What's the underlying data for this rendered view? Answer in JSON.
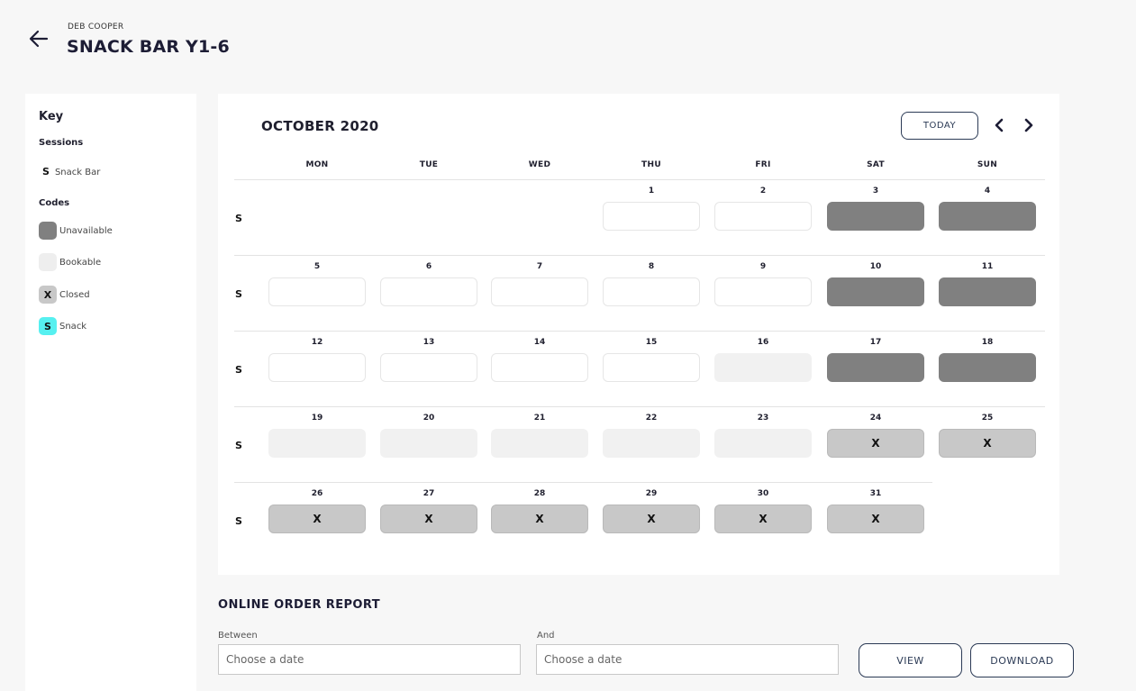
{
  "header": {
    "subtitle": "DEB COOPER",
    "title": "SNACK BAR Y1-6"
  },
  "key": {
    "title": "Key",
    "sessions_label": "Sessions",
    "session": {
      "letter": "S",
      "name": "Snack Bar"
    },
    "codes_label": "Codes",
    "codes": [
      {
        "label": "Unavailable",
        "glyph": "",
        "color": "#808080"
      },
      {
        "label": "Bookable",
        "glyph": "",
        "color": "#eeeeee"
      },
      {
        "label": "Closed",
        "glyph": "X",
        "color": "#c8c8c8"
      },
      {
        "label": "Snack",
        "glyph": "S",
        "color": "#56f0f0"
      }
    ]
  },
  "calendar": {
    "month": "OCTOBER 2020",
    "today_label": "TODAY",
    "weekdays": [
      "MON",
      "TUE",
      "WED",
      "THU",
      "FRI",
      "SAT",
      "SUN"
    ],
    "session_letter": "S",
    "closed_mark": "X",
    "weeks": [
      [
        null,
        null,
        null,
        {
          "d": "1",
          "s": "bookable"
        },
        {
          "d": "2",
          "s": "bookable"
        },
        {
          "d": "3",
          "s": "unavailable"
        },
        {
          "d": "4",
          "s": "unavailable"
        }
      ],
      [
        {
          "d": "5",
          "s": "bookable"
        },
        {
          "d": "6",
          "s": "bookable"
        },
        {
          "d": "7",
          "s": "bookable"
        },
        {
          "d": "8",
          "s": "bookable"
        },
        {
          "d": "9",
          "s": "bookable"
        },
        {
          "d": "10",
          "s": "unavailable"
        },
        {
          "d": "11",
          "s": "unavailable"
        }
      ],
      [
        {
          "d": "12",
          "s": "bookable"
        },
        {
          "d": "13",
          "s": "bookable"
        },
        {
          "d": "14",
          "s": "bookable"
        },
        {
          "d": "15",
          "s": "bookable"
        },
        {
          "d": "16",
          "s": "past"
        },
        {
          "d": "17",
          "s": "unavailable"
        },
        {
          "d": "18",
          "s": "unavailable"
        }
      ],
      [
        {
          "d": "19",
          "s": "past"
        },
        {
          "d": "20",
          "s": "past"
        },
        {
          "d": "21",
          "s": "past"
        },
        {
          "d": "22",
          "s": "past"
        },
        {
          "d": "23",
          "s": "past"
        },
        {
          "d": "24",
          "s": "closed"
        },
        {
          "d": "25",
          "s": "closed"
        }
      ],
      [
        {
          "d": "26",
          "s": "closed"
        },
        {
          "d": "27",
          "s": "closed"
        },
        {
          "d": "28",
          "s": "closed"
        },
        {
          "d": "29",
          "s": "closed"
        },
        {
          "d": "30",
          "s": "closed"
        },
        {
          "d": "31",
          "s": "closed"
        },
        null
      ]
    ]
  },
  "report": {
    "title": "ONLINE ORDER REPORT",
    "between_label": "Between",
    "and_label": "And",
    "placeholder": "Choose a date",
    "view_label": "VIEW",
    "download_label": "DOWNLOAD"
  }
}
